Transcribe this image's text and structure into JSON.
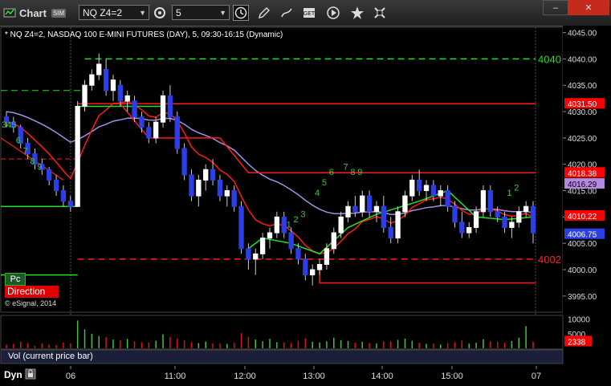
{
  "window": {
    "title": "Chart",
    "sim_badge": "SIM",
    "symbol": "NQ Z4=2",
    "interval": "5",
    "toolbar_icons": [
      "clock-icon",
      "edit-pencil-icon",
      "draw-arrow-icon",
      "get-icon",
      "play-icon",
      "star-icon",
      "cross-tools-icon"
    ],
    "min_label": "–",
    "close_label": "✕"
  },
  "chart": {
    "header": "* NQ Z4=2, NASDAQ 100 E-MINI FUTURES (DAY), 5, 09:30-16:15 (Dynamic)",
    "copyright": "© eSignal, 2014",
    "pc_label": "Pc",
    "direction_label": "Direction",
    "price_axis_ticks": [
      "4045.00",
      "4040.00",
      "4035.00",
      "4030.00",
      "4025.00",
      "4020.00",
      "4015.00",
      "4010.00",
      "4005.00",
      "4000.00",
      "3995.00"
    ],
    "tags": [
      {
        "label": "4031.50",
        "bg": "#ff0000",
        "fg": "#ffffff"
      },
      {
        "label": "4018.38",
        "bg": "#ff0000",
        "fg": "#ffffff"
      },
      {
        "label": "4016.29",
        "bg": "#b38ae0",
        "fg": "#000000"
      },
      {
        "label": "4010.22",
        "bg": "#ff0000",
        "fg": "#ffffff"
      },
      {
        "label": "4006.75",
        "bg": "#2c3fe6",
        "fg": "#ffffff"
      }
    ],
    "level_labels": [
      {
        "label": "4040",
        "color": "#22e022"
      },
      {
        "label": "4002",
        "color": "#ff2020"
      }
    ],
    "count_labels": [
      "345",
      "6",
      "7",
      "8",
      "9",
      "1",
      "2",
      "3",
      "4",
      "5",
      "6",
      "7",
      "8",
      "9",
      "1",
      "2"
    ]
  },
  "volume": {
    "ticks": [
      "10000",
      "5000"
    ],
    "last_tag": "2338",
    "last_tag_bg": "#ff0000",
    "legend": "Vol (current price bar)"
  },
  "time_axis": {
    "dyn_label": "Dyn",
    "labels": [
      "06",
      "11:00",
      "12:00",
      "13:00",
      "14:00",
      "15:00",
      "07"
    ]
  },
  "chart_data": {
    "type": "candlestick",
    "ylim": [
      3993,
      4046
    ],
    "candles": [
      [
        4029,
        4030,
        4027,
        4028
      ],
      [
        4028,
        4029,
        4026,
        4027
      ],
      [
        4027,
        4027.5,
        4023,
        4024
      ],
      [
        4024,
        4025,
        4021,
        4022
      ],
      [
        4022,
        4023,
        4019,
        4020
      ],
      [
        4020,
        4021,
        4018,
        4019
      ],
      [
        4019,
        4019.5,
        4016,
        4017
      ],
      [
        4017,
        4018,
        4014,
        4015
      ],
      [
        4015,
        4016,
        4012,
        4013
      ],
      [
        4013,
        4014,
        4011,
        4012
      ],
      [
        4012,
        4032,
        4012,
        4031
      ],
      [
        4031,
        4036,
        4030,
        4035
      ],
      [
        4035,
        4038,
        4034,
        4037
      ],
      [
        4037,
        4041,
        4036,
        4039
      ],
      [
        4038,
        4040,
        4033,
        4034
      ],
      [
        4034,
        4037,
        4032,
        4036
      ],
      [
        4035,
        4036,
        4031,
        4032
      ],
      [
        4032,
        4034,
        4030,
        4033
      ],
      [
        4032,
        4033,
        4028,
        4029
      ],
      [
        4029,
        4030,
        4026,
        4027
      ],
      [
        4027,
        4028,
        4024,
        4025
      ],
      [
        4025,
        4029,
        4024,
        4028
      ],
      [
        4028,
        4034,
        4027,
        4033
      ],
      [
        4033,
        4035,
        4028,
        4029
      ],
      [
        4029,
        4030,
        4022,
        4023
      ],
      [
        4023,
        4024,
        4017,
        4018
      ],
      [
        4018,
        4019,
        4013,
        4014
      ],
      [
        4014,
        4018,
        4012,
        4017
      ],
      [
        4017,
        4020,
        4015,
        4019
      ],
      [
        4019,
        4021,
        4016,
        4017
      ],
      [
        4017,
        4018,
        4013,
        4014
      ],
      [
        4014,
        4016,
        4012,
        4015
      ],
      [
        4015,
        4016,
        4011,
        4012
      ],
      [
        4012,
        4013,
        4003,
        4004
      ],
      [
        4004,
        4005,
        4000,
        4002
      ],
      [
        4002,
        4004,
        3999,
        4003
      ],
      [
        4003,
        4007,
        4002,
        4006
      ],
      [
        4006,
        4008,
        4004,
        4007
      ],
      [
        4007,
        4011,
        4006,
        4010
      ],
      [
        4010,
        4011,
        4006,
        4007
      ],
      [
        4007,
        4008,
        4003,
        4004
      ],
      [
        4004,
        4005,
        4001,
        4002
      ],
      [
        4002,
        4003,
        3998,
        3999
      ],
      [
        3999,
        4001,
        3997,
        4000
      ],
      [
        4000,
        4002,
        3999,
        4001
      ],
      [
        4001,
        4005,
        4000,
        4004
      ],
      [
        4004,
        4008,
        4003,
        4007
      ],
      [
        4007,
        4011,
        4006,
        4010
      ],
      [
        4010,
        4013,
        4009,
        4012
      ],
      [
        4012,
        4014,
        4010,
        4011
      ],
      [
        4011,
        4015,
        4010,
        4014
      ],
      [
        4014,
        4015,
        4010,
        4011
      ],
      [
        4011,
        4013,
        4009,
        4012
      ],
      [
        4012,
        4014,
        4007,
        4008
      ],
      [
        4008,
        4010,
        4005,
        4006
      ],
      [
        4006,
        4012,
        4005,
        4011
      ],
      [
        4011,
        4015,
        4010,
        4014
      ],
      [
        4014,
        4018,
        4013,
        4017
      ],
      [
        4017,
        4019,
        4014,
        4015
      ],
      [
        4015,
        4017,
        4013,
        4016
      ],
      [
        4016,
        4017,
        4013,
        4014
      ],
      [
        4014,
        4016,
        4012,
        4015
      ],
      [
        4015,
        4016,
        4011,
        4012
      ],
      [
        4012,
        4013,
        4008,
        4009
      ],
      [
        4009,
        4011,
        4006,
        4007
      ],
      [
        4007,
        4009,
        4006,
        4008
      ],
      [
        4008,
        4012,
        4007,
        4011
      ],
      [
        4011,
        4016,
        4010,
        4015
      ],
      [
        4015,
        4016,
        4010,
        4011
      ],
      [
        4011,
        4012,
        4009,
        4010
      ],
      [
        4010,
        4011,
        4007,
        4008
      ],
      [
        4008,
        4010,
        4006,
        4009
      ],
      [
        4009,
        4012,
        4008,
        4011
      ],
      [
        4011,
        4013,
        4010,
        4012
      ],
      [
        4012,
        4013,
        4005,
        4007
      ]
    ],
    "volumes": [
      1200,
      1500,
      2200,
      1800,
      900,
      1600,
      1300,
      1100,
      2000,
      1700,
      9500,
      6500,
      5000,
      4200,
      3800,
      3000,
      2700,
      3200,
      2400,
      2100,
      2000,
      2600,
      4800,
      3900,
      3300,
      2700,
      2100,
      1800,
      2300,
      1700,
      1600,
      1500,
      1900,
      5200,
      4000,
      3000,
      2400,
      3200,
      2100,
      2000,
      1800,
      2600,
      3400,
      2200,
      2000,
      2400,
      3600,
      2800,
      2500,
      1900,
      2200,
      1800,
      1600,
      2400,
      2300,
      2900,
      3300,
      2600,
      1900,
      1500,
      1600,
      1300,
      1800,
      2100,
      2700,
      1600,
      1900,
      3100,
      2400,
      2200,
      1900,
      2500,
      3600,
      7600,
      2338
    ]
  }
}
